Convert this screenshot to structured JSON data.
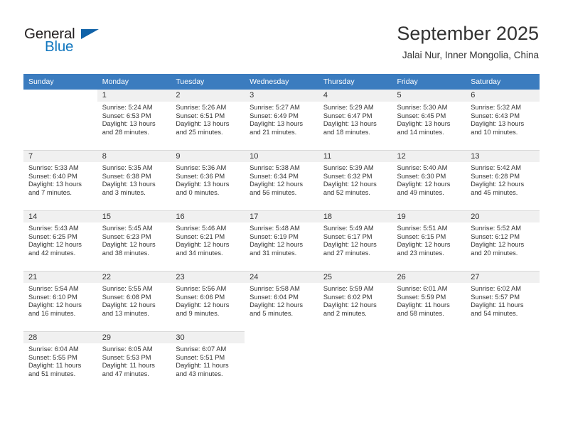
{
  "brand": {
    "name_top": "General",
    "name_bottom": "Blue",
    "accent_color": "#1277bf",
    "triangle_color": "#1062a8"
  },
  "header": {
    "title": "September 2025",
    "location": "Jalai Nur, Inner Mongolia, China"
  },
  "calendar": {
    "header_bg": "#3b7cbf",
    "daynum_bg": "#f0f0f0",
    "weekday_headers": [
      "Sunday",
      "Monday",
      "Tuesday",
      "Wednesday",
      "Thursday",
      "Friday",
      "Saturday"
    ],
    "weeks": [
      [
        {
          "day": "",
          "lines": []
        },
        {
          "day": "1",
          "lines": [
            "Sunrise: 5:24 AM",
            "Sunset: 6:53 PM",
            "Daylight: 13 hours",
            "and 28 minutes."
          ]
        },
        {
          "day": "2",
          "lines": [
            "Sunrise: 5:26 AM",
            "Sunset: 6:51 PM",
            "Daylight: 13 hours",
            "and 25 minutes."
          ]
        },
        {
          "day": "3",
          "lines": [
            "Sunrise: 5:27 AM",
            "Sunset: 6:49 PM",
            "Daylight: 13 hours",
            "and 21 minutes."
          ]
        },
        {
          "day": "4",
          "lines": [
            "Sunrise: 5:29 AM",
            "Sunset: 6:47 PM",
            "Daylight: 13 hours",
            "and 18 minutes."
          ]
        },
        {
          "day": "5",
          "lines": [
            "Sunrise: 5:30 AM",
            "Sunset: 6:45 PM",
            "Daylight: 13 hours",
            "and 14 minutes."
          ]
        },
        {
          "day": "6",
          "lines": [
            "Sunrise: 5:32 AM",
            "Sunset: 6:43 PM",
            "Daylight: 13 hours",
            "and 10 minutes."
          ]
        }
      ],
      [
        {
          "day": "7",
          "lines": [
            "Sunrise: 5:33 AM",
            "Sunset: 6:40 PM",
            "Daylight: 13 hours",
            "and 7 minutes."
          ]
        },
        {
          "day": "8",
          "lines": [
            "Sunrise: 5:35 AM",
            "Sunset: 6:38 PM",
            "Daylight: 13 hours",
            "and 3 minutes."
          ]
        },
        {
          "day": "9",
          "lines": [
            "Sunrise: 5:36 AM",
            "Sunset: 6:36 PM",
            "Daylight: 13 hours",
            "and 0 minutes."
          ]
        },
        {
          "day": "10",
          "lines": [
            "Sunrise: 5:38 AM",
            "Sunset: 6:34 PM",
            "Daylight: 12 hours",
            "and 56 minutes."
          ]
        },
        {
          "day": "11",
          "lines": [
            "Sunrise: 5:39 AM",
            "Sunset: 6:32 PM",
            "Daylight: 12 hours",
            "and 52 minutes."
          ]
        },
        {
          "day": "12",
          "lines": [
            "Sunrise: 5:40 AM",
            "Sunset: 6:30 PM",
            "Daylight: 12 hours",
            "and 49 minutes."
          ]
        },
        {
          "day": "13",
          "lines": [
            "Sunrise: 5:42 AM",
            "Sunset: 6:28 PM",
            "Daylight: 12 hours",
            "and 45 minutes."
          ]
        }
      ],
      [
        {
          "day": "14",
          "lines": [
            "Sunrise: 5:43 AM",
            "Sunset: 6:25 PM",
            "Daylight: 12 hours",
            "and 42 minutes."
          ]
        },
        {
          "day": "15",
          "lines": [
            "Sunrise: 5:45 AM",
            "Sunset: 6:23 PM",
            "Daylight: 12 hours",
            "and 38 minutes."
          ]
        },
        {
          "day": "16",
          "lines": [
            "Sunrise: 5:46 AM",
            "Sunset: 6:21 PM",
            "Daylight: 12 hours",
            "and 34 minutes."
          ]
        },
        {
          "day": "17",
          "lines": [
            "Sunrise: 5:48 AM",
            "Sunset: 6:19 PM",
            "Daylight: 12 hours",
            "and 31 minutes."
          ]
        },
        {
          "day": "18",
          "lines": [
            "Sunrise: 5:49 AM",
            "Sunset: 6:17 PM",
            "Daylight: 12 hours",
            "and 27 minutes."
          ]
        },
        {
          "day": "19",
          "lines": [
            "Sunrise: 5:51 AM",
            "Sunset: 6:15 PM",
            "Daylight: 12 hours",
            "and 23 minutes."
          ]
        },
        {
          "day": "20",
          "lines": [
            "Sunrise: 5:52 AM",
            "Sunset: 6:12 PM",
            "Daylight: 12 hours",
            "and 20 minutes."
          ]
        }
      ],
      [
        {
          "day": "21",
          "lines": [
            "Sunrise: 5:54 AM",
            "Sunset: 6:10 PM",
            "Daylight: 12 hours",
            "and 16 minutes."
          ]
        },
        {
          "day": "22",
          "lines": [
            "Sunrise: 5:55 AM",
            "Sunset: 6:08 PM",
            "Daylight: 12 hours",
            "and 13 minutes."
          ]
        },
        {
          "day": "23",
          "lines": [
            "Sunrise: 5:56 AM",
            "Sunset: 6:06 PM",
            "Daylight: 12 hours",
            "and 9 minutes."
          ]
        },
        {
          "day": "24",
          "lines": [
            "Sunrise: 5:58 AM",
            "Sunset: 6:04 PM",
            "Daylight: 12 hours",
            "and 5 minutes."
          ]
        },
        {
          "day": "25",
          "lines": [
            "Sunrise: 5:59 AM",
            "Sunset: 6:02 PM",
            "Daylight: 12 hours",
            "and 2 minutes."
          ]
        },
        {
          "day": "26",
          "lines": [
            "Sunrise: 6:01 AM",
            "Sunset: 5:59 PM",
            "Daylight: 11 hours",
            "and 58 minutes."
          ]
        },
        {
          "day": "27",
          "lines": [
            "Sunrise: 6:02 AM",
            "Sunset: 5:57 PM",
            "Daylight: 11 hours",
            "and 54 minutes."
          ]
        }
      ],
      [
        {
          "day": "28",
          "lines": [
            "Sunrise: 6:04 AM",
            "Sunset: 5:55 PM",
            "Daylight: 11 hours",
            "and 51 minutes."
          ]
        },
        {
          "day": "29",
          "lines": [
            "Sunrise: 6:05 AM",
            "Sunset: 5:53 PM",
            "Daylight: 11 hours",
            "and 47 minutes."
          ]
        },
        {
          "day": "30",
          "lines": [
            "Sunrise: 6:07 AM",
            "Sunset: 5:51 PM",
            "Daylight: 11 hours",
            "and 43 minutes."
          ]
        },
        {
          "day": "",
          "lines": []
        },
        {
          "day": "",
          "lines": []
        },
        {
          "day": "",
          "lines": []
        },
        {
          "day": "",
          "lines": []
        }
      ]
    ]
  }
}
